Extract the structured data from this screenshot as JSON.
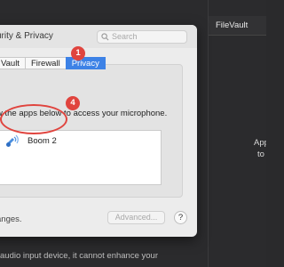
{
  "window": {
    "title": "urity & Privacy",
    "search_placeholder": "Search"
  },
  "tabs": [
    {
      "label": "Vault"
    },
    {
      "label": "Firewall"
    },
    {
      "label": "Privacy",
      "active": true
    }
  ],
  "privacy": {
    "description": "w the apps below to access your microphone.",
    "apps": [
      {
        "name": "Boom 2",
        "icon": "boom-speaker-icon"
      }
    ],
    "changes_text": "anges.",
    "advanced_label": "Advanced...",
    "help_label": "?"
  },
  "background": {
    "right_header": "FileVault",
    "right_text_line1": "App",
    "right_text_line2": "to",
    "bottom_text": "audio input device, it cannot enhance your"
  },
  "annotations": {
    "badge1": "1",
    "badge4": "4",
    "color": "#e0443e"
  }
}
